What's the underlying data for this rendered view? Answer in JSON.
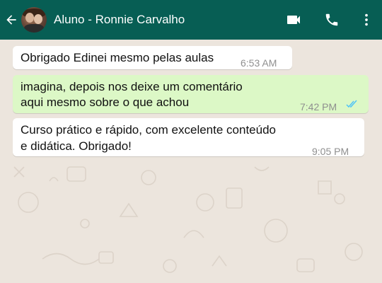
{
  "header": {
    "title": "Aluno - Ronnie Carvalho",
    "icons": [
      "back-arrow-icon",
      "avatar",
      "video-call-icon",
      "phone-icon",
      "more-vert-icon"
    ]
  },
  "messages": [
    {
      "direction": "incoming",
      "text": "Obrigado Edinei mesmo pelas aulas",
      "time": "6:53 AM"
    },
    {
      "direction": "outgoing",
      "line1": "imagina, depois nos deixe um comentário",
      "line2": "aqui mesmo sobre o que achou",
      "time": "7:42 PM",
      "status": "read-double-check-icon"
    },
    {
      "direction": "incoming",
      "line1": "Curso prático e rápido, com excelente conteúdo",
      "line2": "e didática. Obrigado!",
      "time": "9:05 PM"
    }
  ],
  "colors": {
    "header": "#075e54",
    "chat_background": "#ece5dd",
    "outgoing_bubble": "#dcf8c6",
    "incoming_bubble": "#ffffff",
    "read_tick": "#4fc3f7"
  }
}
